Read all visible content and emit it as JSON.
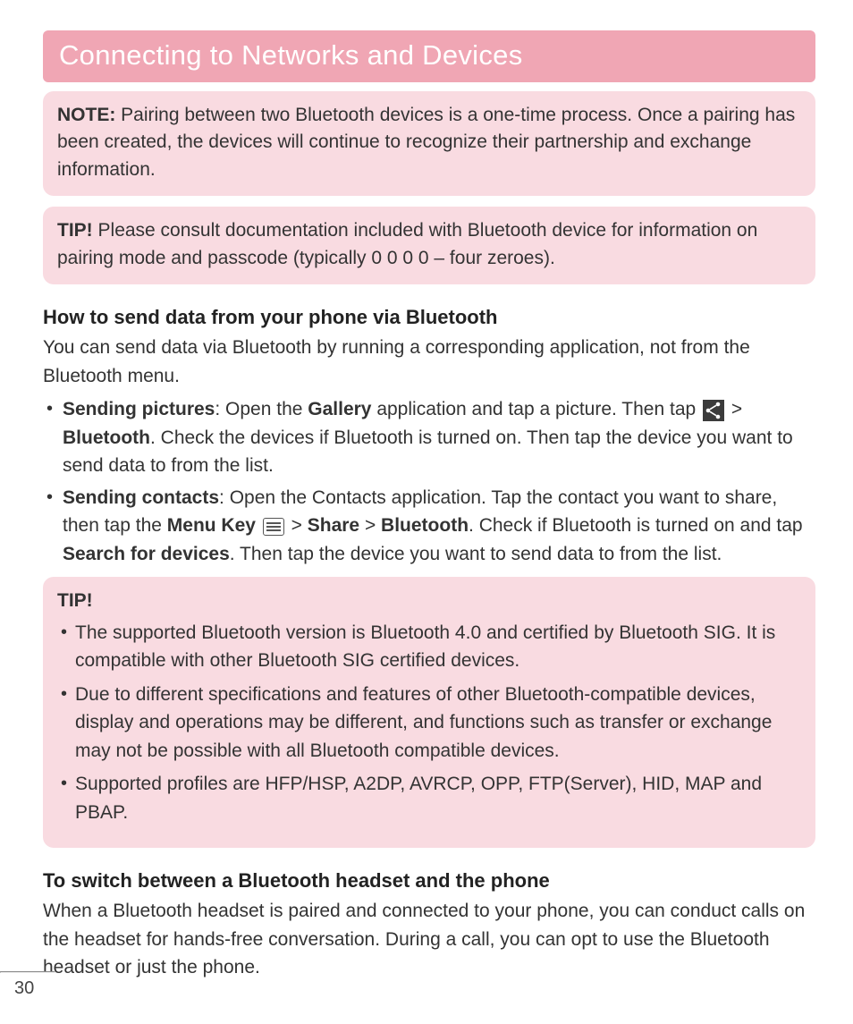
{
  "header": {
    "title": "Connecting to Networks and Devices"
  },
  "note_box": {
    "label": "NOTE:",
    "text": "Pairing between two Bluetooth devices is a one-time process. Once a pairing has been created, the devices will continue to recognize their partnership and exchange information."
  },
  "tip_box_1": {
    "label": "TIP!",
    "text": "Please consult documentation included with Bluetooth device for information on pairing mode and passcode (typically 0 0 0 0 – four zeroes)."
  },
  "section_send": {
    "heading": "How to send data from your phone via Bluetooth",
    "intro": "You can send data via Bluetooth by running a corresponding application, not from the Bluetooth menu.",
    "bullet1": {
      "lead": "Sending pictures",
      "t1": ": Open the ",
      "b1": "Gallery",
      "t2": " application and tap a picture. Then tap ",
      "t3": " > ",
      "b2": "Bluetooth",
      "t4": ". Check the devices if Bluetooth is turned on. Then tap the device you want to send data to from the list."
    },
    "bullet2": {
      "lead": "Sending contacts",
      "t1": ": Open the Contacts application. Tap the contact you want to share, then tap the ",
      "b1": "Menu Key",
      "t2": " ",
      "t3": " > ",
      "b2": "Share",
      "t4": " > ",
      "b3": "Bluetooth",
      "t5": ". Check if Bluetooth is turned on and tap ",
      "b4": "Search for devices",
      "t6": ". Then tap the device you want to send data to from the list."
    }
  },
  "tip_box_2": {
    "label": "TIP!",
    "items": [
      "The supported Bluetooth version is Bluetooth 4.0 and certified by Bluetooth SIG. It is compatible with other Bluetooth SIG certified devices.",
      "Due to different specifications and features of other Bluetooth-compatible devices, display and operations may be different, and functions such as transfer or exchange may not be possible with all Bluetooth compatible devices.",
      "Supported profiles are HFP/HSP, A2DP, AVRCP, OPP, FTP(Server), HID, MAP and PBAP."
    ]
  },
  "section_switch": {
    "heading": "To switch between a Bluetooth headset and the phone",
    "intro": "When a Bluetooth headset is paired and connected to your phone, you can conduct calls on the headset for hands-free conversation. During a call, you can opt to use the Bluetooth headset or just the phone."
  },
  "page_number": "30"
}
